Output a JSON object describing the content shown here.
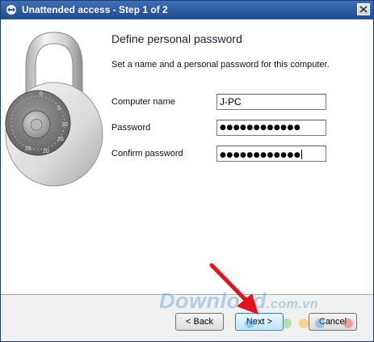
{
  "window": {
    "title": "Unattended access - Step 1 of 2",
    "icons": {
      "app": "teamviewer-icon",
      "close": "close-icon"
    }
  },
  "main": {
    "heading": "Define personal password",
    "description": "Set a name and a personal password for this computer.",
    "fields": {
      "computer_name": {
        "label": "Computer name",
        "value": "J-PC"
      },
      "password": {
        "label": "Password",
        "value": "●●●●●●●●●●●●"
      },
      "confirm_password": {
        "label": "Confirm password",
        "value": "●●●●●●●●●●●●"
      }
    },
    "illustration": "combination-padlock-image"
  },
  "footer": {
    "back_label": "< Back",
    "next_label": "Next >",
    "cancel_label": "Cancel"
  },
  "overlay": {
    "watermark_text": "Download",
    "watermark_suffix": ".com.vn",
    "annotation": "red-arrow-pointing-to-next-button"
  },
  "colors": {
    "title_bar": "#2c5a9f",
    "default_button": "#bee6fd",
    "annotation_arrow": "#e3131b",
    "watermark": "#5096c8"
  }
}
